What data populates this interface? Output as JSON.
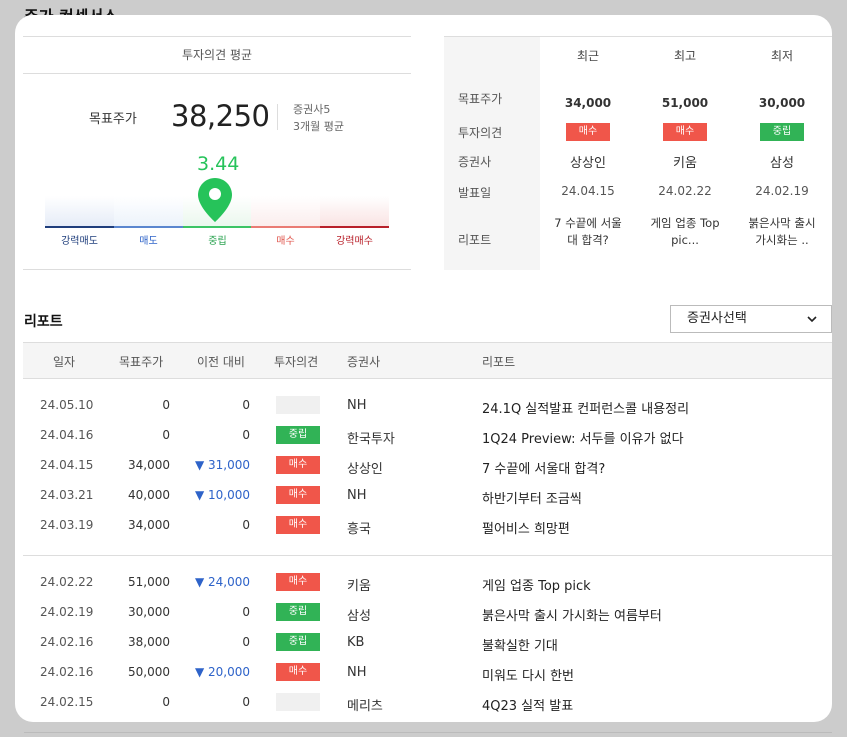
{
  "page_title": "주가 컨센서스",
  "consensus": {
    "header": "투자의견 평균",
    "target_label": "목표주가",
    "target_value": "38,250",
    "broker_count": "증권사5",
    "period": "3개월 평균",
    "score": "3.44",
    "score_level": 0.55,
    "gauge_labels": [
      "강력매도",
      "매도",
      "중립",
      "매수",
      "강력매수"
    ]
  },
  "summary": {
    "columns": [
      "최근",
      "최고",
      "최저"
    ],
    "row_labels": [
      "목표주가",
      "투자의견",
      "증권사",
      "발표일",
      "리포트"
    ],
    "cols": [
      {
        "target": "34,000",
        "opinion": "매수",
        "broker": "상상인",
        "date": "24.04.15",
        "report_l1": "7 수끝에 서울",
        "report_l2": "대 합격?"
      },
      {
        "target": "51,000",
        "opinion": "매수",
        "broker": "키움",
        "date": "24.02.22",
        "report_l1": "게임 업종 Top",
        "report_l2": "pic..."
      },
      {
        "target": "30,000",
        "opinion": "중립",
        "broker": "삼성",
        "date": "24.02.19",
        "report_l1": "붉은사막 출시",
        "report_l2": "가시화는 .."
      }
    ]
  },
  "reports": {
    "title": "리포트",
    "select_label": "증권사선택",
    "headers": [
      "일자",
      "목표주가",
      "이전 대비",
      "투자의견",
      "증권사",
      "리포트"
    ],
    "rows": [
      {
        "date": "24.05.10",
        "target": "0",
        "change": "0",
        "opinion": "",
        "broker": "NH",
        "title": "24.1Q 실적발표 컨퍼런스콜 내용정리"
      },
      {
        "date": "24.04.16",
        "target": "0",
        "change": "0",
        "opinion": "중립",
        "broker": "한국투자",
        "title": "1Q24 Preview: 서두를 이유가 없다"
      },
      {
        "date": "24.04.15",
        "target": "34,000",
        "change": "▼ 31,000",
        "opinion": "매수",
        "broker": "상상인",
        "title": "7 수끝에 서울대 합격?"
      },
      {
        "date": "24.03.21",
        "target": "40,000",
        "change": "▼ 10,000",
        "opinion": "매수",
        "broker": "NH",
        "title": "하반기부터 조금씩"
      },
      {
        "date": "24.03.19",
        "target": "34,000",
        "change": "0",
        "opinion": "매수",
        "broker": "흥국",
        "title": "펄어비스 희망편"
      },
      {
        "date": "24.02.22",
        "target": "51,000",
        "change": "▼ 24,000",
        "opinion": "매수",
        "broker": "키움",
        "title": "게임 업종 Top pick"
      },
      {
        "date": "24.02.19",
        "target": "30,000",
        "change": "0",
        "opinion": "중립",
        "broker": "삼성",
        "title": "붉은사막 출시 가시화는 여름부터"
      },
      {
        "date": "24.02.16",
        "target": "38,000",
        "change": "0",
        "opinion": "중립",
        "broker": "KB",
        "title": "불확실한 기대"
      },
      {
        "date": "24.02.16",
        "target": "50,000",
        "change": "▼ 20,000",
        "opinion": "매수",
        "broker": "NH",
        "title": "미워도 다시 한번"
      },
      {
        "date": "24.02.15",
        "target": "0",
        "change": "0",
        "opinion": "",
        "broker": "메리츠",
        "title": "4Q23 실적 발표"
      }
    ]
  },
  "colors": {
    "buy": "#f0564a",
    "neutral": "#31b356",
    "score": "#26c35a",
    "down": "#2e63c9"
  }
}
